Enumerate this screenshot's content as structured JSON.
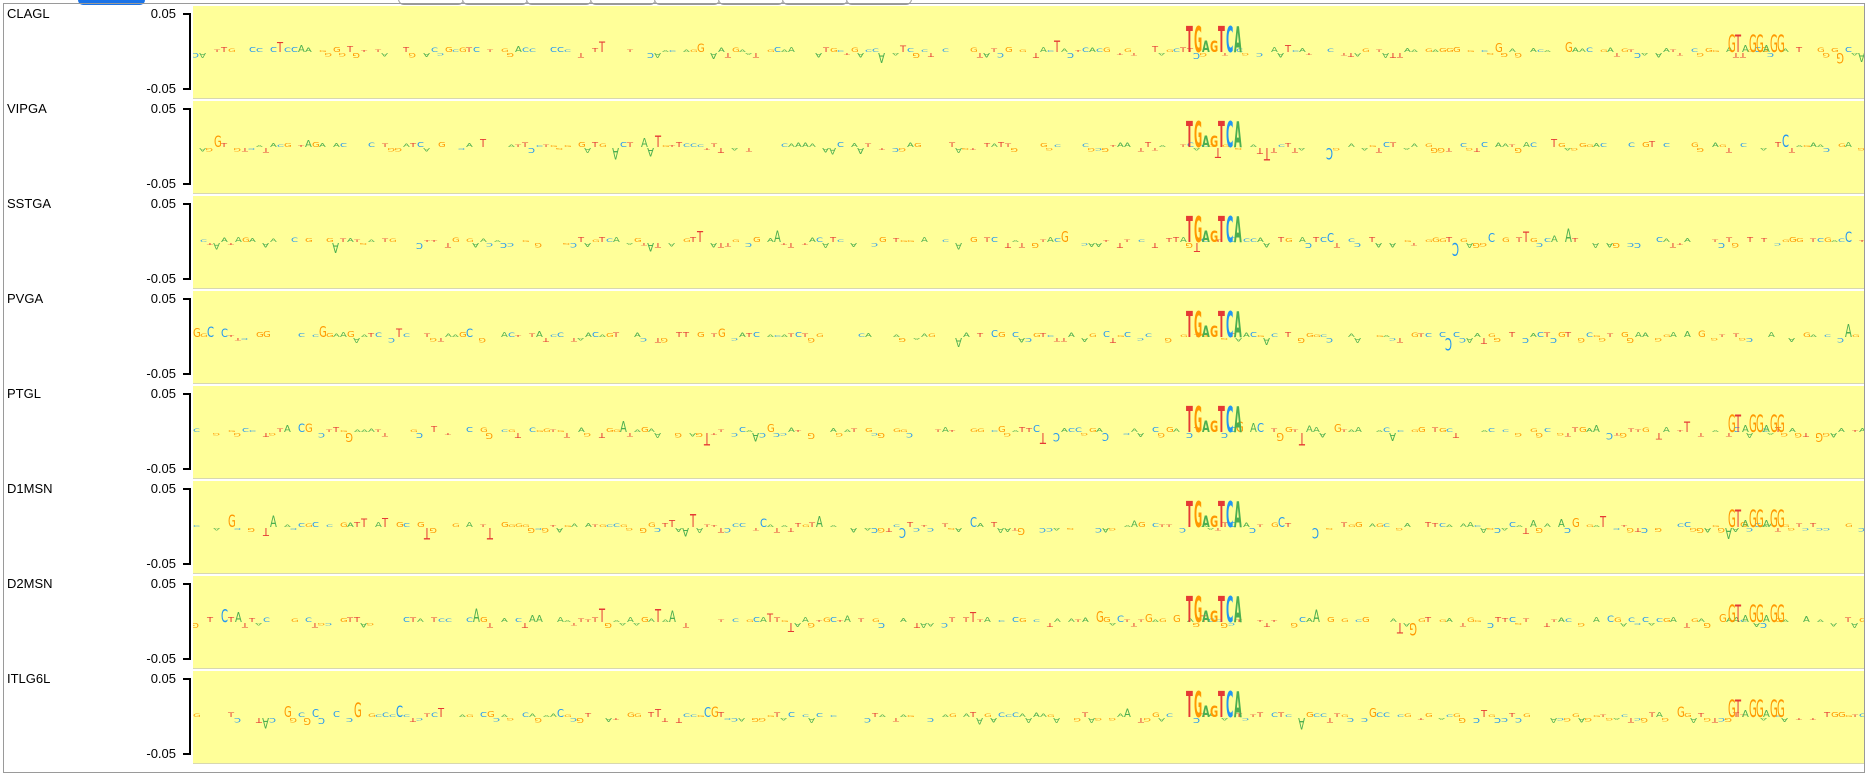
{
  "axis": {
    "top_label": "0.05",
    "bottom_label": "-0.05"
  },
  "colors": {
    "background": "#ffff99",
    "A": "#4caf50",
    "C": "#2196f3",
    "G": "#ff9800",
    "T": "#e53935",
    "accent_tab": "#1a73e8"
  },
  "motif_letters": [
    "T",
    "G",
    "A",
    "G",
    "T",
    "C",
    "A"
  ],
  "tracks": [
    {
      "label": "CLAGL"
    },
    {
      "label": "VIPGA"
    },
    {
      "label": "SSTGA"
    },
    {
      "label": "PVGA"
    },
    {
      "label": "PTGL"
    },
    {
      "label": "D1MSN"
    },
    {
      "label": "D2MSN"
    },
    {
      "label": "ITLG6L"
    }
  ]
}
